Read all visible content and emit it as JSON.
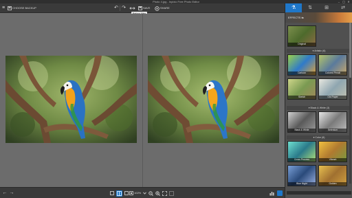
{
  "window": {
    "title": "Photo 4.jpg - Inpixio Free Photo Editor",
    "min": "–",
    "max": "▢",
    "close": "✕"
  },
  "toolbar": {
    "menu_icon": "≡",
    "choose_label": "CHOOSE BACKUP",
    "undo_icon": "↶",
    "redo_icon": "↷",
    "save_label": "SAVE",
    "share_label": "SHARE",
    "tooltip": "Before  After"
  },
  "status": {
    "zoom": "102%",
    "prev": "←",
    "next": "→"
  },
  "sidebar": {
    "tabs": [
      "⚗",
      "⇅",
      "⊞",
      "⇄"
    ],
    "effects_label": "EFFECTS ⇆",
    "sections": [
      {
        "label": "▾ Artistic (6)"
      },
      {
        "label": "▾ Black & White (3)"
      },
      {
        "label": "▾ Color (6)"
      }
    ],
    "thumbs": [
      {
        "label": "Original"
      },
      {
        "label": "Cartoon"
      },
      {
        "label": "Colored Pencil"
      },
      {
        "label": "Sketch"
      },
      {
        "label": "Old Paper"
      },
      {
        "label": "Black & White"
      },
      {
        "label": "Selenium"
      },
      {
        "label": "Cross Process"
      },
      {
        "label": "Vibrant"
      },
      {
        "label": "Blue Night"
      },
      {
        "label": "Golden"
      }
    ]
  }
}
